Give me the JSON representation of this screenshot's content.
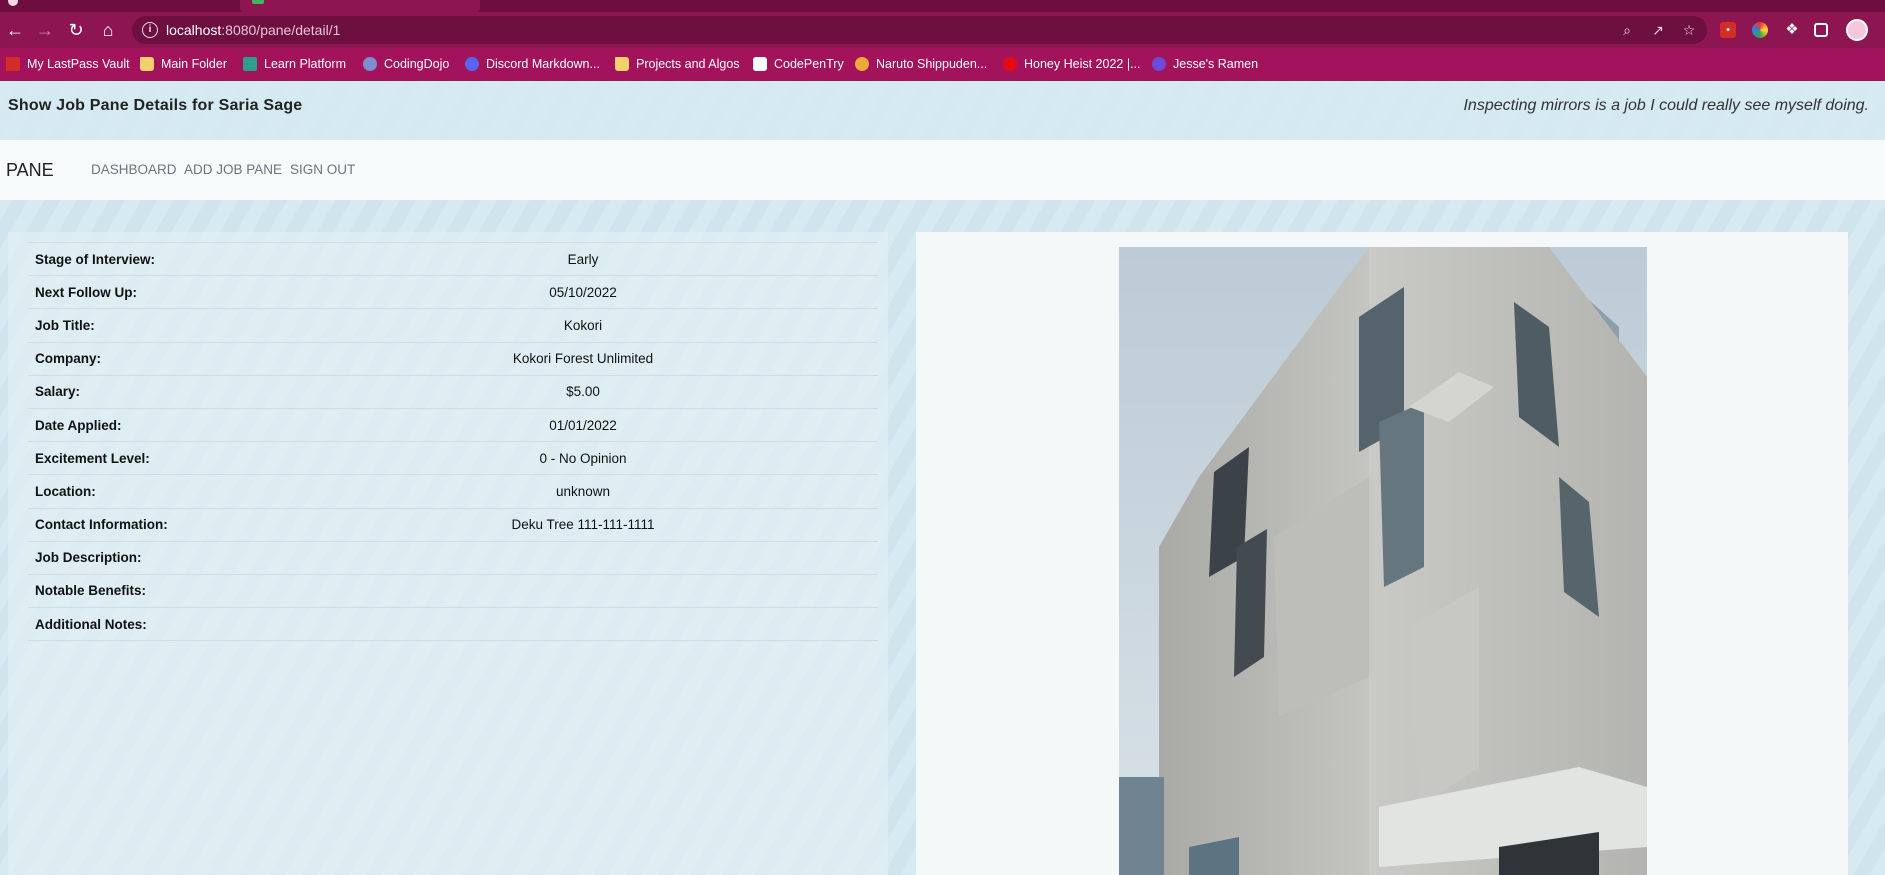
{
  "browser": {
    "url_host": "localhost",
    "url_path": ":8080/pane/detail/1",
    "bookmarks": [
      {
        "label": "My LastPass Vault",
        "icon": "lastpass-icon"
      },
      {
        "label": "Main Folder",
        "icon": "folder-icon"
      },
      {
        "label": "Learn Platform",
        "icon": "learn-platform-icon"
      },
      {
        "label": "CodingDojo",
        "icon": "codingdojo-icon"
      },
      {
        "label": "Discord Markdown...",
        "icon": "discord-icon"
      },
      {
        "label": "Projects and Algos",
        "icon": "folder-icon"
      },
      {
        "label": "CodePenTry",
        "icon": "codepen-icon"
      },
      {
        "label": "Naruto Shippuden...",
        "icon": "naruto-icon"
      },
      {
        "label": "Honey Heist 2022 |...",
        "icon": "netflix-icon"
      },
      {
        "label": "Jesse's Ramen",
        "icon": "ramen-icon"
      }
    ]
  },
  "header": {
    "title": "Show Job Pane Details for Saria Sage",
    "quote": "Inspecting mirrors is a job I could really see myself doing."
  },
  "nav": {
    "brand": "PANE",
    "links": [
      "DASHBOARD",
      "ADD JOB PANE",
      "SIGN OUT"
    ]
  },
  "details": [
    {
      "label": "Stage of Interview:",
      "value": "Early"
    },
    {
      "label": "Next Follow Up:",
      "value": "05/10/2022"
    },
    {
      "label": "Job Title:",
      "value": "Kokori"
    },
    {
      "label": "Company:",
      "value": "Kokori Forest Unlimited"
    },
    {
      "label": "Salary:",
      "value": "$5.00"
    },
    {
      "label": "Date Applied:",
      "value": "01/01/2022"
    },
    {
      "label": "Excitement Level:",
      "value": "0 - No Opinion"
    },
    {
      "label": "Location:",
      "value": "unknown"
    },
    {
      "label": "Contact Information:",
      "value": "Deku Tree 111-111-1111"
    },
    {
      "label": "Job Description:",
      "value": ""
    },
    {
      "label": "Notable Benefits:",
      "value": ""
    },
    {
      "label": "Additional Notes:",
      "value": ""
    }
  ],
  "colors": {
    "chrome_dark": "#6e0e3e",
    "chrome_toolbar": "#8c1552",
    "bookmark_bar": "#a3135c",
    "page_background": "#d6eaf1"
  }
}
